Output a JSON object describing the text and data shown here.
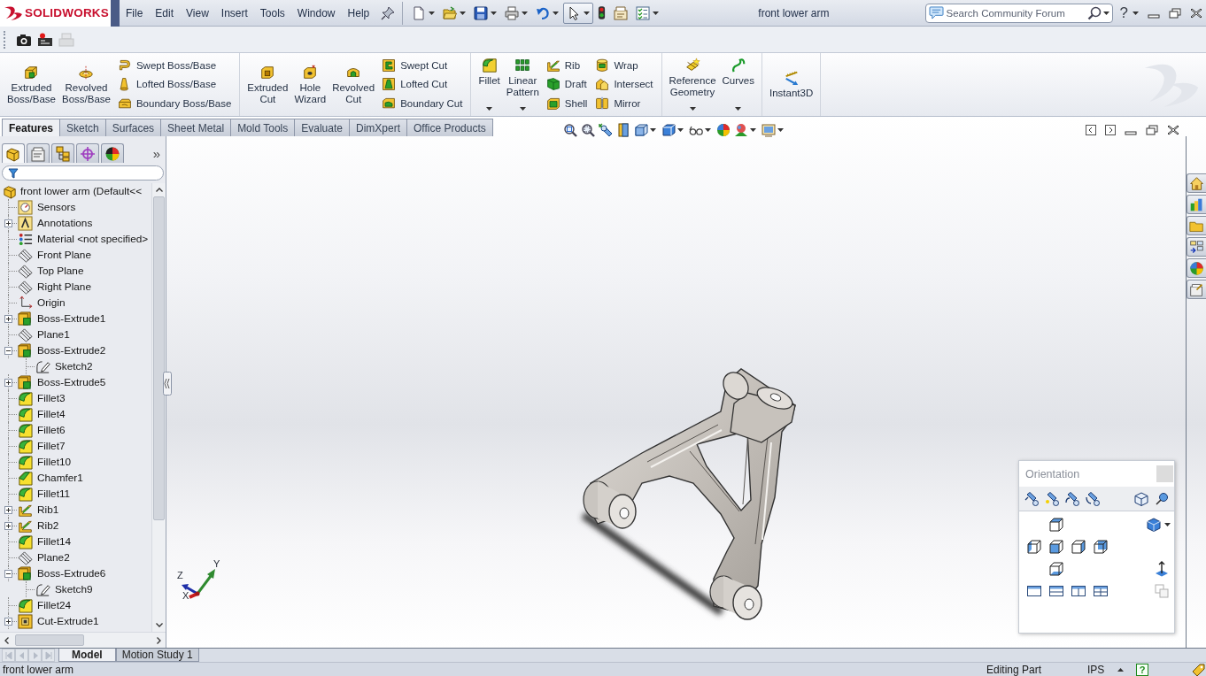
{
  "title_bar": {
    "logo": "SOLIDWORKS",
    "menu": [
      "File",
      "Edit",
      "View",
      "Insert",
      "Tools",
      "Window",
      "Help"
    ],
    "tools": [
      {
        "kind": "new",
        "dropdown": true,
        "pressed": false
      },
      {
        "kind": "open",
        "dropdown": true,
        "pressed": false
      },
      {
        "kind": "save",
        "dropdown": true,
        "pressed": false
      },
      {
        "kind": "print",
        "dropdown": true,
        "pressed": false
      },
      {
        "kind": "undo",
        "dropdown": true,
        "pressed": false
      },
      {
        "kind": "select",
        "dropdown": true,
        "pressed": true
      },
      {
        "kind": "rebuild",
        "dropdown": false,
        "pressed": false
      },
      {
        "kind": "options",
        "dropdown": false,
        "pressed": false
      },
      {
        "kind": "checklist",
        "dropdown": true,
        "pressed": false
      }
    ],
    "title": "front lower arm",
    "search": {
      "placeholder": "Search Community Forum"
    },
    "help": "?"
  },
  "capture_toolbar": [
    {
      "kind": "camera",
      "disabled": false
    },
    {
      "kind": "record",
      "disabled": false
    },
    {
      "kind": "print",
      "disabled": true
    }
  ],
  "ribbon": {
    "groups": [
      {
        "buttons": [
          {
            "kind": "boss",
            "label": "Extruded Boss/Base",
            "dropdown": false
          },
          {
            "kind": "revolve",
            "label": "Revolved Boss/Base",
            "dropdown": false
          }
        ],
        "stacks": [
          [
            {
              "kind": "sweep",
              "label": "Swept Boss/Base"
            },
            {
              "kind": "loft",
              "label": "Lofted Boss/Base"
            },
            {
              "kind": "boundary",
              "label": "Boundary Boss/Base"
            }
          ]
        ]
      },
      {
        "buttons": [
          {
            "kind": "cut",
            "label": "Extruded Cut",
            "dropdown": false
          },
          {
            "kind": "hole",
            "label": "Hole Wizard",
            "dropdown": false
          },
          {
            "kind": "revolvecut",
            "label": "Revolved Cut",
            "dropdown": false
          }
        ],
        "stacks": [
          [
            {
              "kind": "sweepcut",
              "label": "Swept Cut"
            },
            {
              "kind": "loftcut",
              "label": "Lofted Cut"
            },
            {
              "kind": "boundarycut",
              "label": "Boundary Cut"
            }
          ]
        ]
      },
      {
        "buttons": [
          {
            "kind": "fillet",
            "label": "Fillet",
            "dropdown": true
          },
          {
            "kind": "pattern",
            "label": "Linear Pattern",
            "dropdown": true
          }
        ],
        "stacks": [
          [
            {
              "kind": "rib",
              "label": "Rib"
            },
            {
              "kind": "draft",
              "label": "Draft"
            },
            {
              "kind": "shell",
              "label": "Shell"
            }
          ],
          [
            {
              "kind": "wrap",
              "label": "Wrap"
            },
            {
              "kind": "intersect",
              "label": "Intersect"
            },
            {
              "kind": "mirror",
              "label": "Mirror"
            }
          ]
        ]
      },
      {
        "buttons": [
          {
            "kind": "reference",
            "label": "Reference Geometry",
            "dropdown": true
          },
          {
            "kind": "curves",
            "label": "Curves",
            "dropdown": true
          }
        ]
      },
      {
        "buttons": [
          {
            "kind": "instant",
            "label": "Instant3D",
            "dropdown": false
          }
        ]
      }
    ]
  },
  "command_tabs": [
    {
      "label": "Features",
      "selected": true
    },
    {
      "label": "Sketch",
      "selected": false
    },
    {
      "label": "Surfaces",
      "selected": false
    },
    {
      "label": "Sheet Metal",
      "selected": false
    },
    {
      "label": "Mold Tools",
      "selected": false
    },
    {
      "label": "Evaluate",
      "selected": false
    },
    {
      "label": "DimXpert",
      "selected": false
    },
    {
      "label": "Office Products",
      "selected": false
    }
  ],
  "feature_manager": {
    "panel_tabs": [
      {
        "kind": "tree",
        "selected": true
      },
      {
        "kind": "property",
        "selected": false
      },
      {
        "kind": "configuration",
        "selected": false
      },
      {
        "kind": "dimxpert",
        "selected": false
      },
      {
        "kind": "display",
        "selected": false
      }
    ],
    "more": "»",
    "tree": {
      "kind": "part",
      "label": "front lower arm (Default<<",
      "children": [
        {
          "kind": "sensor",
          "label": "Sensors"
        },
        {
          "kind": "annotation",
          "label": "Annotations",
          "expanded": false
        },
        {
          "kind": "material",
          "label": "Material <not specified>"
        },
        {
          "kind": "plane",
          "label": "Front Plane"
        },
        {
          "kind": "plane",
          "label": "Top Plane"
        },
        {
          "kind": "plane",
          "label": "Right Plane"
        },
        {
          "kind": "origin",
          "label": "Origin"
        },
        {
          "kind": "extrude",
          "label": "Boss-Extrude1",
          "expanded": false
        },
        {
          "kind": "plane",
          "label": "Plane1"
        },
        {
          "kind": "extrude",
          "label": "Boss-Extrude2",
          "expanded": true,
          "children": [
            {
              "kind": "sketch",
              "label": "Sketch2"
            }
          ]
        },
        {
          "kind": "extrude",
          "label": "Boss-Extrude5",
          "expanded": false
        },
        {
          "kind": "fillet",
          "label": "Fillet3"
        },
        {
          "kind": "fillet",
          "label": "Fillet4"
        },
        {
          "kind": "fillet",
          "label": "Fillet6"
        },
        {
          "kind": "fillet",
          "label": "Fillet7"
        },
        {
          "kind": "fillet",
          "label": "Fillet10"
        },
        {
          "kind": "chamfer",
          "label": "Chamfer1"
        },
        {
          "kind": "fillet",
          "label": "Fillet11"
        },
        {
          "kind": "rib",
          "label": "Rib1",
          "expanded": false
        },
        {
          "kind": "rib",
          "label": "Rib2",
          "expanded": false
        },
        {
          "kind": "fillet",
          "label": "Fillet14"
        },
        {
          "kind": "plane",
          "label": "Plane2"
        },
        {
          "kind": "extrude",
          "label": "Boss-Extrude6",
          "expanded": true,
          "children": [
            {
              "kind": "sketch",
              "label": "Sketch9"
            }
          ]
        },
        {
          "kind": "fillet",
          "label": "Fillet24"
        },
        {
          "kind": "cut",
          "label": "Cut-Extrude1",
          "expanded": false
        }
      ]
    }
  },
  "viewport": {
    "triad_labels": [
      "Y",
      "Z",
      "X"
    ],
    "orientation_panel": {
      "title": "Orientation"
    }
  },
  "bottom_tabs": [
    {
      "label": "Model",
      "selected": true
    },
    {
      "label": "Motion Study 1",
      "selected": false
    }
  ],
  "status_bar": {
    "document": "front lower arm",
    "mode": "Editing Part",
    "units": "IPS",
    "help": "?"
  }
}
